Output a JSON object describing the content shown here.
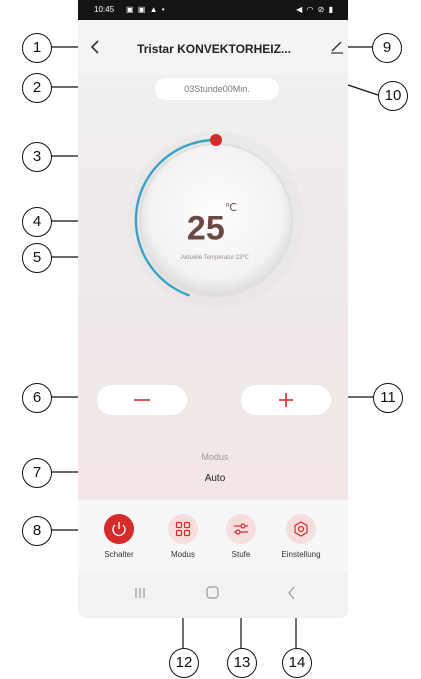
{
  "status_bar": {
    "time": "10:45",
    "left_icons": "▣ ▣ ▲ •",
    "right_icons": "◀ ◠ ⊘ ▮"
  },
  "header": {
    "title": "Tristar KONVEKTORHEIZ..."
  },
  "timer": {
    "text": "03Stunde00Min."
  },
  "thermostat": {
    "temperature": "25",
    "unit": "℃",
    "current_label": "Aktuelle Temperatur 23℃",
    "dial_level_percent": 58
  },
  "mode": {
    "label": "Modus",
    "value": "Auto"
  },
  "bottom_buttons": [
    {
      "label": "Schalter",
      "icon": "power-icon"
    },
    {
      "label": "Modus",
      "icon": "grid-icon"
    },
    {
      "label": "Stufe",
      "icon": "sliders-icon"
    },
    {
      "label": "Einstellung",
      "icon": "settings-icon"
    }
  ],
  "callouts": [
    "1",
    "2",
    "3",
    "4",
    "5",
    "6",
    "7",
    "8",
    "9",
    "10",
    "11",
    "12",
    "13",
    "14"
  ],
  "colors": {
    "accent": "#d62b2b",
    "dial_arc": "#3aa2c9",
    "temp_text": "#6b4a45"
  }
}
